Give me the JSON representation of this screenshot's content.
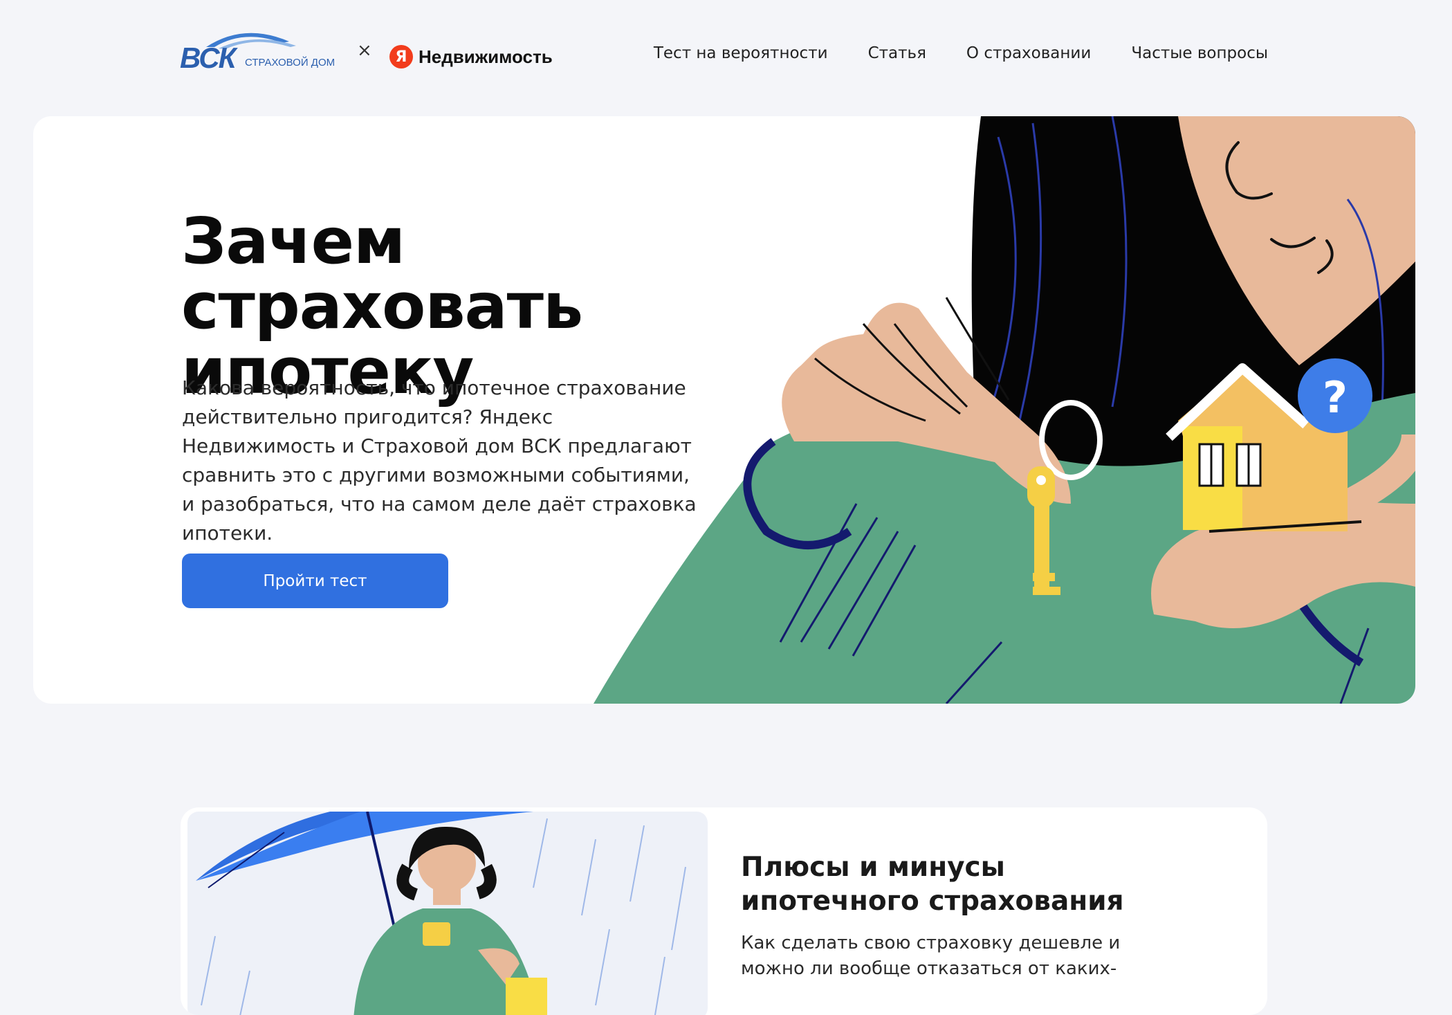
{
  "header": {
    "logo_vsk_mark": "ВСК",
    "logo_vsk_sub": "СТРАХОВОЙ ДОМ",
    "separator": "×",
    "logo_yandex_letter": "Я",
    "logo_yandex_text": "Недвижимость",
    "nav": [
      {
        "label": "Тест на вероятности"
      },
      {
        "label": "Статья"
      },
      {
        "label": "О страховании"
      },
      {
        "label": "Частые вопросы"
      }
    ]
  },
  "hero": {
    "title": "Зачем страховать ипотеку",
    "description": "Какова вероятность, что ипотечное страхование действительно пригодится? Яндекс Недвижимость и Страховой дом ВСК предлагают сравнить это с другими возможными событиями, и разобраться, что на самом деле даёт страховка ипотеки.",
    "cta_label": "Пройти тест",
    "question_mark": "?"
  },
  "card": {
    "title": "Плюсы и минусы ипотечного страхования",
    "description": "Как сделать свою страховку дешевле и можно ли вообще отказаться от каких-"
  },
  "colors": {
    "accent": "#3070e0",
    "background": "#f4f5f9",
    "yandex_red": "#f23c1c",
    "vsk_blue": "#2b5fae",
    "illustration_green": "#5ca685",
    "skin": "#e8b99a",
    "key_yellow": "#f5cf45"
  },
  "icons": {
    "question_badge": "question-icon",
    "key": "key-icon",
    "house": "house-icon",
    "umbrella": "umbrella-icon"
  }
}
